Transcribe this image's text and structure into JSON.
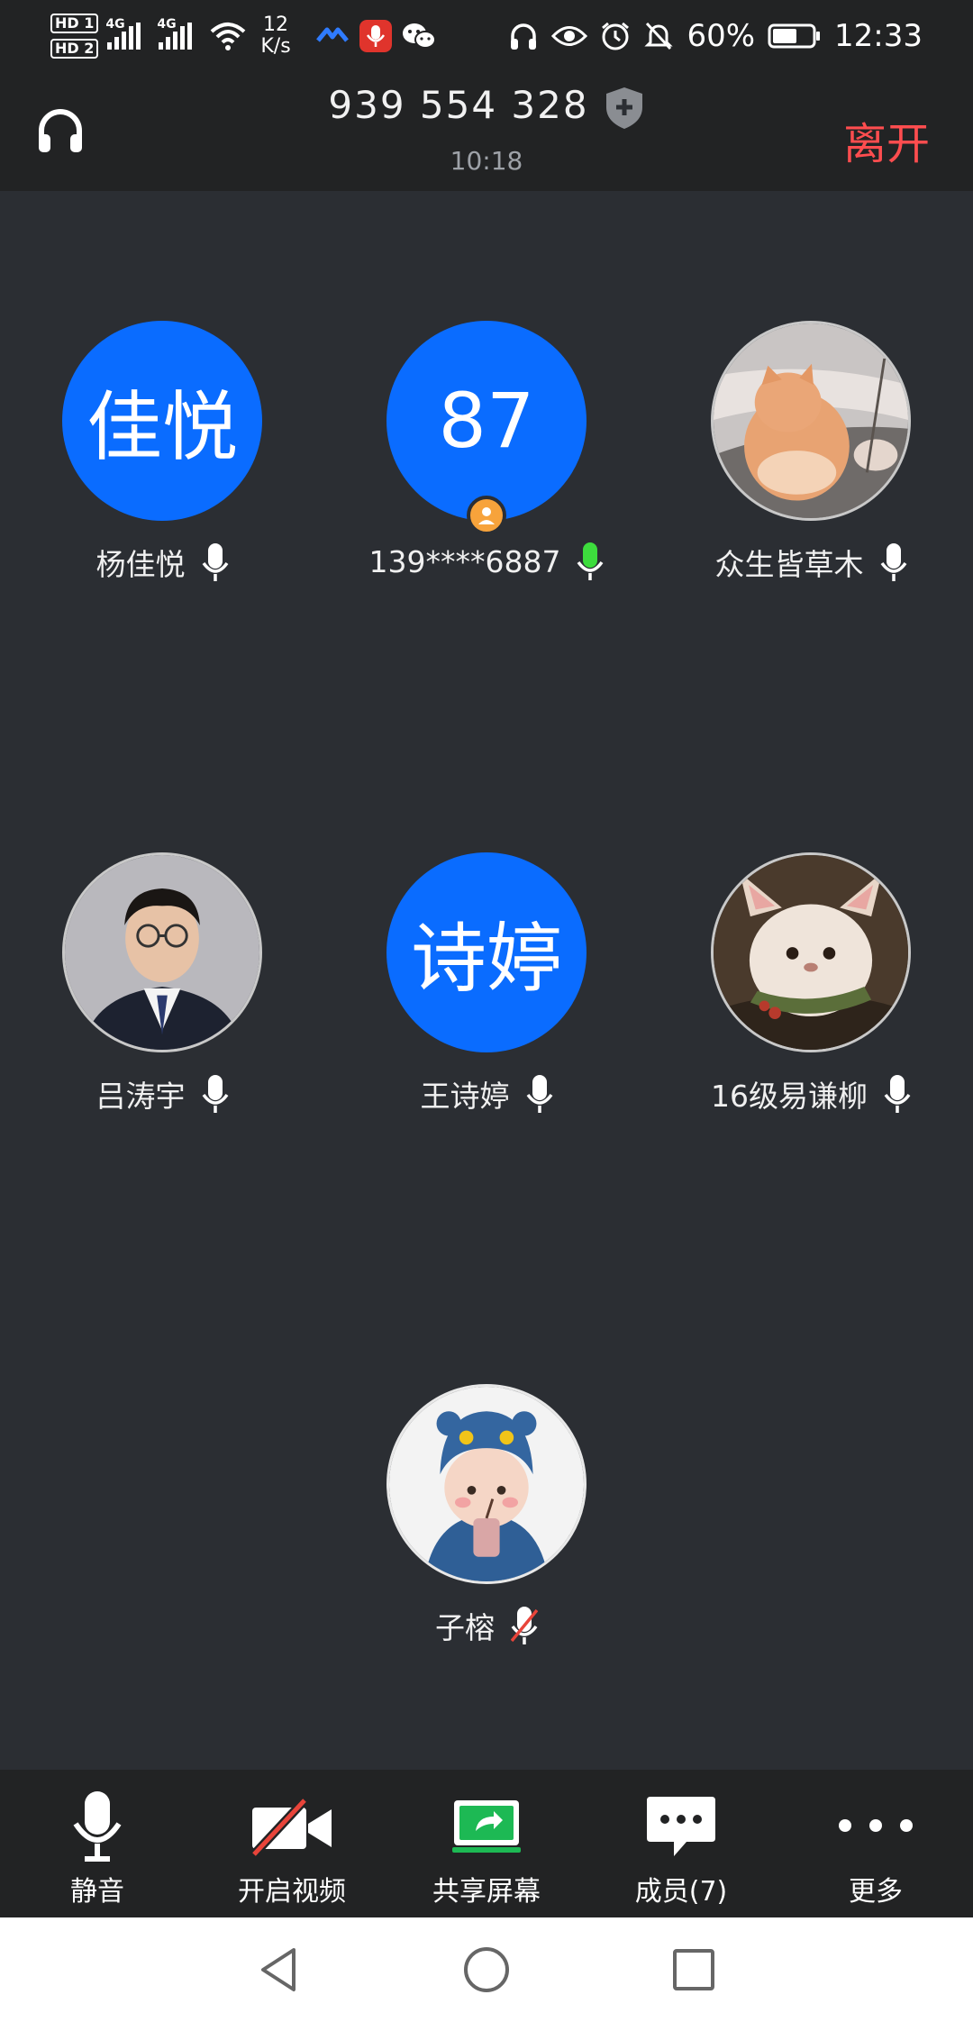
{
  "status_bar": {
    "hd1": "HD 1",
    "hd2": "HD 2",
    "net1": "4G",
    "net2": "4G",
    "speed_value": "12",
    "speed_unit": "K/s",
    "battery_percent": "60%",
    "time": "12:33"
  },
  "header": {
    "meeting_id": "939 554 328",
    "duration": "10:18",
    "leave_label": "离开"
  },
  "participants": [
    {
      "avatar_text": "佳悦",
      "name": "杨佳悦",
      "mic": "on"
    },
    {
      "avatar_text": "87",
      "name": "139****6887",
      "mic": "speaking"
    },
    {
      "avatar_text": "",
      "name": "众生皆草木",
      "mic": "on"
    },
    {
      "avatar_text": "",
      "name": "吕涛宇",
      "mic": "on"
    },
    {
      "avatar_text": "诗婷",
      "name": "王诗婷",
      "mic": "on"
    },
    {
      "avatar_text": "",
      "name": "16级易谦柳",
      "mic": "on"
    },
    {
      "avatar_text": "",
      "name": "子榕",
      "mic": "muted"
    }
  ],
  "toolbar": {
    "mute_label": "静音",
    "video_label": "开启视频",
    "share_label": "共享屏幕",
    "members_label": "成员(7)",
    "more_label": "更多"
  },
  "colors": {
    "accent_blue": "#0a6cff",
    "leave_red": "#ff4d4f",
    "speaking_green": "#3ddc3d",
    "share_green": "#1db954",
    "background": "#2b2e33"
  }
}
